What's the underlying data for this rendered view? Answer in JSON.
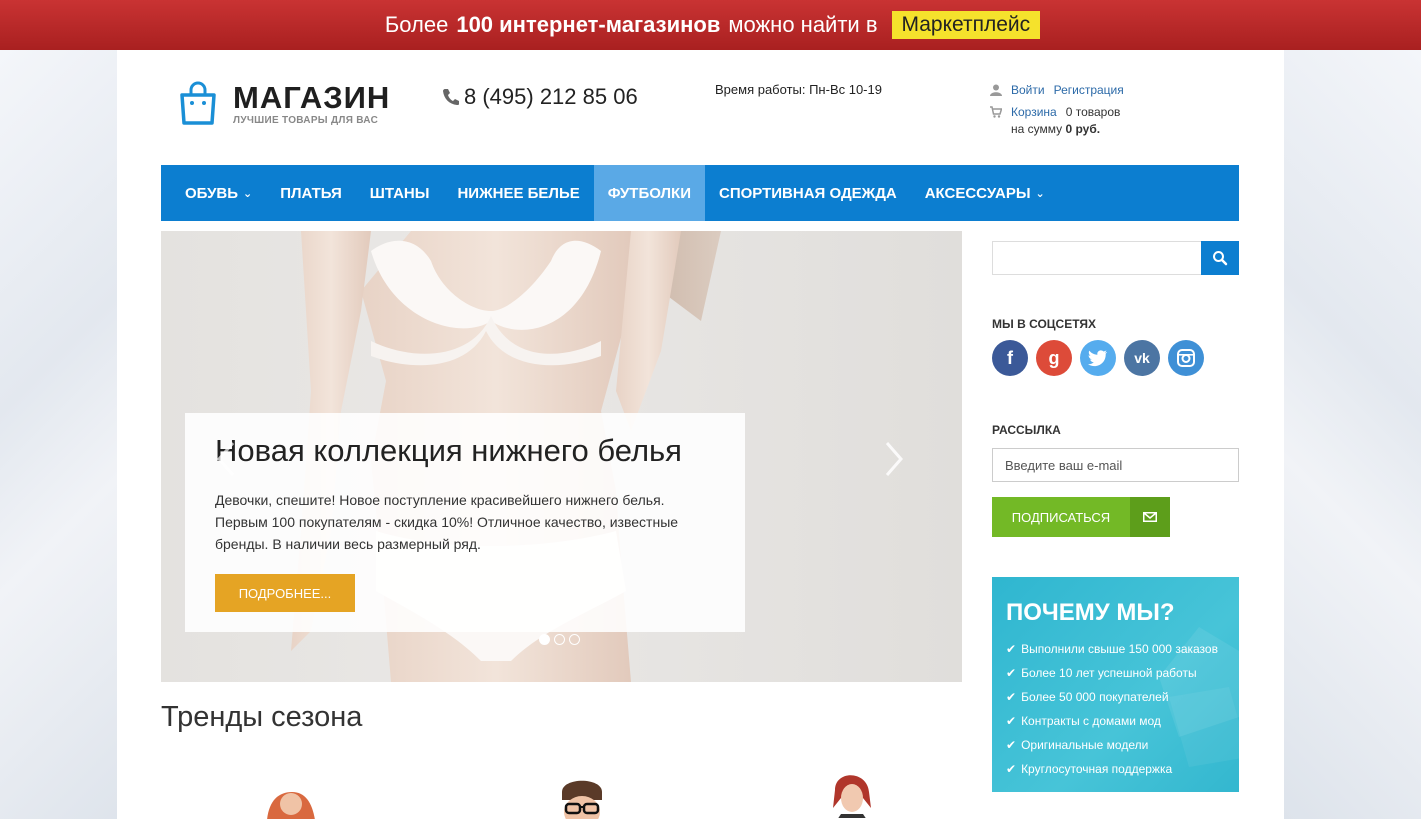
{
  "banner": {
    "part1": "Более",
    "bold": "100 интернет-магазинов",
    "part2": "можно найти в",
    "marketplace": "Маркетплейс"
  },
  "header": {
    "logo_title": "МАГАЗИН",
    "logo_subtitle": "ЛУЧШИЕ ТОВАРЫ ДЛЯ ВАС",
    "phone": "8 (495) 212 85 06",
    "hours": "Время работы: Пн-Вс 10-19",
    "login": "Войти",
    "register": "Регистрация",
    "cart": "Корзина",
    "cart_count": "0 товаров",
    "sum_label": "на сумму",
    "sum_value": "0 руб."
  },
  "nav": {
    "items": [
      {
        "label": "ОБУВЬ",
        "dropdown": true
      },
      {
        "label": "ПЛАТЬЯ"
      },
      {
        "label": "ШТАНЫ"
      },
      {
        "label": "НИЖНЕЕ БЕЛЬЕ"
      },
      {
        "label": "ФУТБОЛКИ",
        "active": true
      },
      {
        "label": "СПОРТИВНАЯ ОДЕЖДА"
      },
      {
        "label": "АКСЕССУАРЫ",
        "dropdown": true
      }
    ]
  },
  "slider": {
    "title": "Новая коллекция нижнего белья",
    "text": "Девочки, спешите! Новое поступление красивейшего нижнего белья. Первым 100 покупателям - скидка 10%! Отличное качество, известные бренды. В наличии весь размерный ряд.",
    "button": "ПОДРОБНЕЕ...",
    "slides_count": 3,
    "active_slide": 1
  },
  "trends": {
    "title": "Тренды сезона"
  },
  "sidebar": {
    "search_placeholder": "",
    "social_title": "МЫ В СОЦСЕТЯХ",
    "socials": [
      "facebook-icon",
      "google-plus-icon",
      "twitter-icon",
      "vk-icon",
      "instagram-icon"
    ],
    "newsletter_title": "РАССЫЛКА",
    "email_placeholder": "Введите ваш e-mail",
    "subscribe": "ПОДПИСАТЬСЯ",
    "why_title": "ПОЧЕМУ МЫ?",
    "why_items": [
      "Выполнили свыше 150 000 заказов",
      "Более 10 лет успешной работы",
      "Более 50 000 покупателей",
      "Контракты с домами мод",
      "Оригинальные модели",
      "Круглосуточная поддержка"
    ]
  },
  "colors": {
    "banner": "#b82727",
    "nav": "#0c7ed0",
    "nav_active": "#5aa9e6",
    "more_button": "#e5a424",
    "subscribe": "#73b926",
    "why_bg": "#35bad2"
  }
}
